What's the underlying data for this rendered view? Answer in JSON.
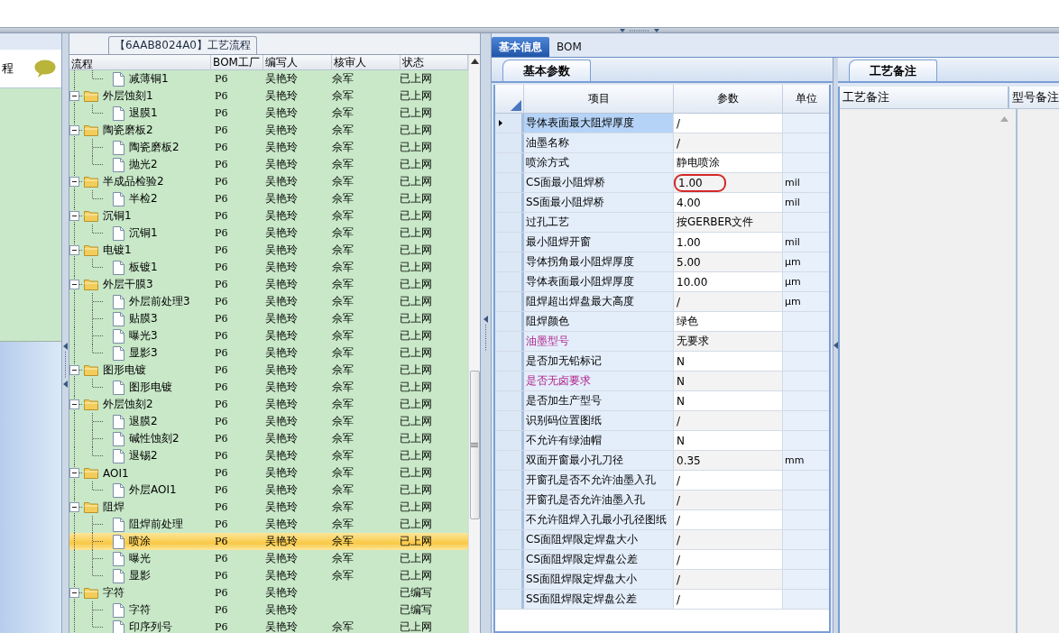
{
  "nav": {
    "label": "程"
  },
  "process_panel": {
    "title": "【6AAB8024A0】工艺流程",
    "columns": [
      "流程",
      "BOM工厂",
      "编写人",
      "核审人",
      "状态"
    ],
    "continued_rows": [
      {
        "name": "减薄铜1",
        "kind": "file",
        "bom": "P6",
        "writer": "吴艳玲",
        "reviewer": "佘军",
        "status": "已上网",
        "selected": false
      }
    ],
    "nodes": [
      {
        "name": "外层蚀刻1",
        "kind": "folder",
        "expanded": true,
        "bom": "P6",
        "writer": "吴艳玲",
        "reviewer": "佘军",
        "status": "已上网",
        "selected": false,
        "children": [
          {
            "name": "退膜1",
            "kind": "file",
            "bom": "P6",
            "writer": "吴艳玲",
            "reviewer": "佘军",
            "status": "已上网",
            "selected": false
          }
        ]
      },
      {
        "name": "陶瓷磨板2",
        "kind": "folder",
        "expanded": true,
        "bom": "P6",
        "writer": "吴艳玲",
        "reviewer": "佘军",
        "status": "已上网",
        "selected": false,
        "children": [
          {
            "name": "陶瓷磨板2",
            "kind": "file",
            "bom": "P6",
            "writer": "吴艳玲",
            "reviewer": "佘军",
            "status": "已上网",
            "selected": false
          },
          {
            "name": "抛光2",
            "kind": "file",
            "bom": "P6",
            "writer": "吴艳玲",
            "reviewer": "佘军",
            "status": "已上网",
            "selected": false
          }
        ]
      },
      {
        "name": "半成品检验2",
        "kind": "folder",
        "expanded": true,
        "bom": "P6",
        "writer": "吴艳玲",
        "reviewer": "佘军",
        "status": "已上网",
        "selected": false,
        "children": [
          {
            "name": "半检2",
            "kind": "file",
            "bom": "P6",
            "writer": "吴艳玲",
            "reviewer": "佘军",
            "status": "已上网",
            "selected": false
          }
        ]
      },
      {
        "name": "沉铜1",
        "kind": "folder",
        "expanded": true,
        "bom": "P6",
        "writer": "吴艳玲",
        "reviewer": "佘军",
        "status": "已上网",
        "selected": false,
        "children": [
          {
            "name": "沉铜1",
            "kind": "file",
            "bom": "P6",
            "writer": "吴艳玲",
            "reviewer": "佘军",
            "status": "已上网",
            "selected": false
          }
        ]
      },
      {
        "name": "电镀1",
        "kind": "folder",
        "expanded": true,
        "bom": "P6",
        "writer": "吴艳玲",
        "reviewer": "佘军",
        "status": "已上网",
        "selected": false,
        "children": [
          {
            "name": "板镀1",
            "kind": "file",
            "bom": "P6",
            "writer": "吴艳玲",
            "reviewer": "佘军",
            "status": "已上网",
            "selected": false
          }
        ]
      },
      {
        "name": "外层干膜3",
        "kind": "folder",
        "expanded": true,
        "bom": "P6",
        "writer": "吴艳玲",
        "reviewer": "佘军",
        "status": "已上网",
        "selected": false,
        "children": [
          {
            "name": "外层前处理3",
            "kind": "file",
            "bom": "P6",
            "writer": "吴艳玲",
            "reviewer": "佘军",
            "status": "已上网",
            "selected": false
          },
          {
            "name": "贴膜3",
            "kind": "file",
            "bom": "P6",
            "writer": "吴艳玲",
            "reviewer": "佘军",
            "status": "已上网",
            "selected": false
          },
          {
            "name": "曝光3",
            "kind": "file",
            "bom": "P6",
            "writer": "吴艳玲",
            "reviewer": "佘军",
            "status": "已上网",
            "selected": false
          },
          {
            "name": "显影3",
            "kind": "file",
            "bom": "P6",
            "writer": "吴艳玲",
            "reviewer": "佘军",
            "status": "已上网",
            "selected": false
          }
        ]
      },
      {
        "name": "图形电镀",
        "kind": "folder",
        "expanded": true,
        "bom": "P6",
        "writer": "吴艳玲",
        "reviewer": "佘军",
        "status": "已上网",
        "selected": false,
        "children": [
          {
            "name": "图形电镀",
            "kind": "file",
            "bom": "P6",
            "writer": "吴艳玲",
            "reviewer": "佘军",
            "status": "已上网",
            "selected": false
          }
        ]
      },
      {
        "name": "外层蚀刻2",
        "kind": "folder",
        "expanded": true,
        "bom": "P6",
        "writer": "吴艳玲",
        "reviewer": "佘军",
        "status": "已上网",
        "selected": false,
        "children": [
          {
            "name": "退膜2",
            "kind": "file",
            "bom": "P6",
            "writer": "吴艳玲",
            "reviewer": "佘军",
            "status": "已上网",
            "selected": false
          },
          {
            "name": "碱性蚀刻2",
            "kind": "file",
            "bom": "P6",
            "writer": "吴艳玲",
            "reviewer": "佘军",
            "status": "已上网",
            "selected": false
          },
          {
            "name": "退锡2",
            "kind": "file",
            "bom": "P6",
            "writer": "吴艳玲",
            "reviewer": "佘军",
            "status": "已上网",
            "selected": false
          }
        ]
      },
      {
        "name": "AOI1",
        "kind": "folder",
        "expanded": true,
        "bom": "P6",
        "writer": "吴艳玲",
        "reviewer": "佘军",
        "status": "已上网",
        "selected": false,
        "children": [
          {
            "name": "外层AOI1",
            "kind": "file",
            "bom": "P6",
            "writer": "吴艳玲",
            "reviewer": "佘军",
            "status": "已上网",
            "selected": false
          }
        ]
      },
      {
        "name": "阻焊",
        "kind": "folder",
        "expanded": true,
        "bom": "P6",
        "writer": "吴艳玲",
        "reviewer": "佘军",
        "status": "已上网",
        "selected": false,
        "children": [
          {
            "name": "阻焊前处理",
            "kind": "file",
            "bom": "P6",
            "writer": "吴艳玲",
            "reviewer": "佘军",
            "status": "已上网",
            "selected": false
          },
          {
            "name": "喷涂",
            "kind": "file",
            "bom": "P6",
            "writer": "吴艳玲",
            "reviewer": "佘军",
            "status": "已上网",
            "selected": true
          },
          {
            "name": "曝光",
            "kind": "file",
            "bom": "P6",
            "writer": "吴艳玲",
            "reviewer": "佘军",
            "status": "已上网",
            "selected": false
          },
          {
            "name": "显影",
            "kind": "file",
            "bom": "P6",
            "writer": "吴艳玲",
            "reviewer": "佘军",
            "status": "已上网",
            "selected": false
          }
        ]
      },
      {
        "name": "字符",
        "kind": "folder",
        "expanded": true,
        "bom": "P6",
        "writer": "吴艳玲",
        "status": "已编写",
        "selected": false,
        "children": [
          {
            "name": "字符",
            "kind": "file",
            "bom": "P6",
            "writer": "吴艳玲",
            "status": "已编写",
            "selected": false
          },
          {
            "name": "印序列号",
            "kind": "file",
            "bom": "P6",
            "writer": "吴艳玲",
            "reviewer": "佘军",
            "status": "已上网",
            "selected": false
          }
        ]
      }
    ]
  },
  "info_tabs": [
    {
      "label": "基本信息",
      "selected": true
    },
    {
      "label": "BOM",
      "selected": false
    }
  ],
  "params_panel": {
    "tab": "基本参数",
    "columns": [
      "项目",
      "参数",
      "单位"
    ],
    "rows": [
      {
        "item": "导体表面最大阻焊厚度",
        "value": "/",
        "highlighted": false,
        "selected": true,
        "circled": false
      },
      {
        "item": "油墨名称",
        "value": "/",
        "highlighted": false,
        "selected": false,
        "circled": false
      },
      {
        "item": "喷涂方式",
        "value": "静电喷涂",
        "highlighted": false,
        "selected": false,
        "circled": false
      },
      {
        "item": "CS面最小阻焊桥",
        "value": "1.00",
        "unit": "mil",
        "highlighted": false,
        "selected": false,
        "circled": true
      },
      {
        "item": "SS面最小阻焊桥",
        "value": "4.00",
        "unit": "mil",
        "highlighted": false,
        "selected": false,
        "circled": false
      },
      {
        "item": "过孔工艺",
        "value": "按GERBER文件",
        "highlighted": false,
        "selected": false,
        "circled": false
      },
      {
        "item": "最小阻焊开窗",
        "value": "1.00",
        "unit": "mil",
        "highlighted": false,
        "selected": false,
        "circled": false
      },
      {
        "item": "导体拐角最小阻焊厚度",
        "value": "5.00",
        "unit": "μm",
        "highlighted": false,
        "selected": false,
        "circled": false
      },
      {
        "item": "导体表面最小阻焊厚度",
        "value": "10.00",
        "unit": "μm",
        "highlighted": false,
        "selected": false,
        "circled": false
      },
      {
        "item": "阻焊超出焊盘最大高度",
        "value": "/",
        "unit": "μm",
        "highlighted": false,
        "selected": false,
        "circled": false
      },
      {
        "item": "阻焊颜色",
        "value": "绿色",
        "highlighted": false,
        "selected": false,
        "circled": false
      },
      {
        "item": "油墨型号",
        "value": "无要求",
        "highlighted": true,
        "selected": false,
        "circled": false
      },
      {
        "item": "是否加无铅标记",
        "value": "N",
        "highlighted": false,
        "selected": false,
        "circled": false
      },
      {
        "item": "是否无卤要求",
        "value": "N",
        "highlighted": true,
        "selected": false,
        "circled": false
      },
      {
        "item": "是否加生产型号",
        "value": "N",
        "highlighted": false,
        "selected": false,
        "circled": false
      },
      {
        "item": "识别码位置图纸",
        "value": "/",
        "highlighted": false,
        "selected": false,
        "circled": false
      },
      {
        "item": "不允许有绿油帽",
        "value": "N",
        "highlighted": false,
        "selected": false,
        "circled": false
      },
      {
        "item": "双面开窗最小孔刀径",
        "value": "0.35",
        "unit": "mm",
        "highlighted": false,
        "selected": false,
        "circled": false
      },
      {
        "item": "开窗孔是否不允许油墨入孔",
        "value": "/",
        "highlighted": false,
        "selected": false,
        "circled": false
      },
      {
        "item": "开窗孔是否允许油墨入孔",
        "value": "/",
        "highlighted": false,
        "selected": false,
        "circled": false
      },
      {
        "item": "不允许阻焊入孔最小孔径图纸",
        "value": "/",
        "highlighted": false,
        "selected": false,
        "circled": false
      },
      {
        "item": "CS面阻焊限定焊盘大小",
        "value": "/",
        "highlighted": false,
        "selected": false,
        "circled": false
      },
      {
        "item": "CS面阻焊限定焊盘公差",
        "value": "/",
        "highlighted": false,
        "selected": false,
        "circled": false
      },
      {
        "item": "SS面阻焊限定焊盘大小",
        "value": "/",
        "highlighted": false,
        "selected": false,
        "circled": false
      },
      {
        "item": "SS面阻焊限定焊盘公差",
        "value": "/",
        "highlighted": false,
        "selected": false,
        "circled": false
      }
    ]
  },
  "notes_panel": {
    "tab": "工艺备注",
    "columns": [
      "工艺备注",
      "型号备注"
    ]
  }
}
